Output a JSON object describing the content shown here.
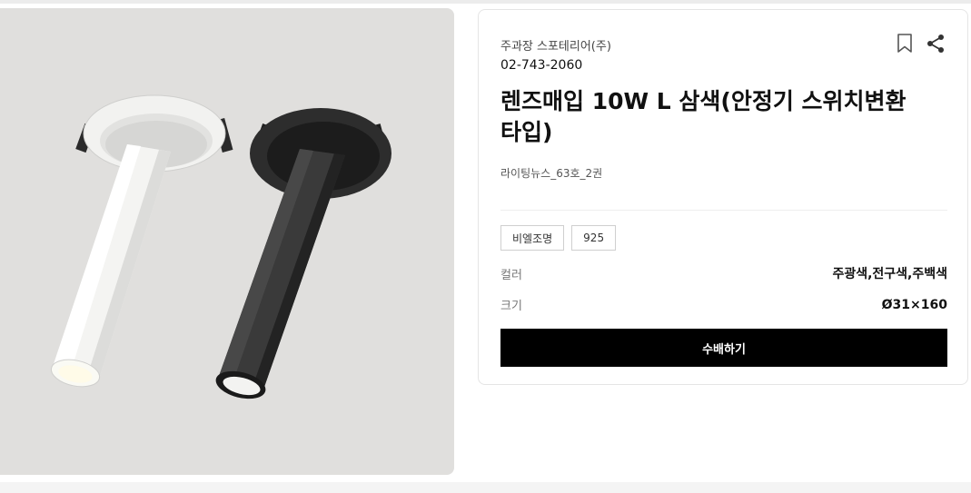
{
  "product": {
    "company": "주과장 스포테리어(주)",
    "phone": "02-743-2060",
    "title": "렌즈매입 10W L 삼색(안정기 스위치변환 타입)",
    "source": "라이팅뉴스_63호_2권",
    "tags": [
      "비엘조명",
      "925"
    ],
    "specs": {
      "color_label": "컬러",
      "color_value": "주광색,전구색,주백색",
      "size_label": "크기",
      "size_value": "Ø31×160"
    },
    "cta_label": "수배하기"
  },
  "icons": {
    "bookmark": "bookmark-icon",
    "share": "share-icon"
  },
  "colors": {
    "cta_bg": "#000000",
    "image_bg": "#e0dfdd"
  }
}
